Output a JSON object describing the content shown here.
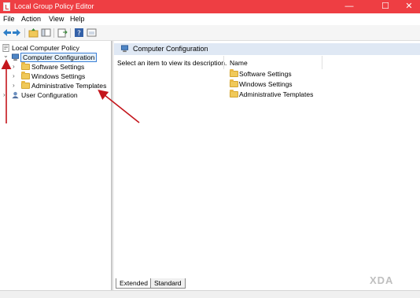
{
  "window": {
    "title": "Local Group Policy Editor",
    "controls": {
      "minimize": "—",
      "maximize": "☐",
      "close": "✕"
    }
  },
  "menu": {
    "items": [
      "File",
      "Action",
      "View",
      "Help"
    ]
  },
  "toolbar": {
    "buttons": [
      "back-icon",
      "forward-icon",
      "up-folder-icon",
      "show-hide-tree-icon",
      "export-list-icon",
      "help-icon",
      "properties-icon"
    ]
  },
  "tree": {
    "root": "Local Computer Policy",
    "computer_config": "Computer Configuration",
    "children": [
      "Software Settings",
      "Windows Settings",
      "Administrative Templates"
    ],
    "user_config": "User Configuration",
    "expander_expanded": "⌄",
    "expander_collapsed": "›"
  },
  "details": {
    "header": "Computer Configuration",
    "description": "Select an item to view its description.",
    "column_name": "Name",
    "items": [
      "Software Settings",
      "Windows Settings",
      "Administrative Templates"
    ]
  },
  "tabs": [
    "Extended",
    "Standard"
  ],
  "watermark": "XDA",
  "colors": {
    "titlebar": "#ee3e43",
    "annotation_arrow": "#c4161c",
    "selection_border": "#3b7fd6"
  }
}
